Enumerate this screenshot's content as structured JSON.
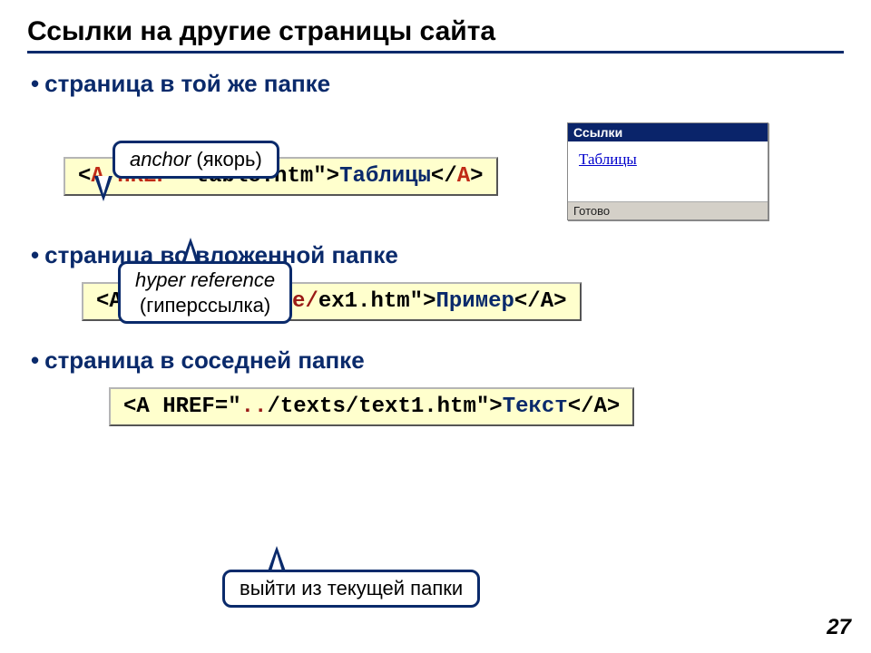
{
  "title": "Ссылки на другие страницы сайта",
  "sections": [
    {
      "heading": "страница в той же папке"
    },
    {
      "heading": "страница во вложенной папке"
    },
    {
      "heading": "страница в соседней папке"
    }
  ],
  "callouts": {
    "anchor": {
      "italic": "anchor",
      "rest": " (якорь)"
    },
    "hyper": {
      "italic": "hyper reference",
      "rest": "(гиперссылка)"
    },
    "exit": {
      "text": "выйти из текущей папки"
    }
  },
  "code1": {
    "lt": "<",
    "a_open": "A",
    "sp": " ",
    "href": "HREF",
    "eq": "=",
    "q1": "\"",
    "url": "table.htm",
    "q2": "\"",
    "gt": ">",
    "text": "Таблицы",
    "lt2": "<",
    "slash": "/",
    "a_close": "A",
    "gt2": ">"
  },
  "code2": {
    "prefix": "<A HREF=\"",
    "path_red": "example/",
    "path_rest": "ex1.htm",
    "mid": "\">",
    "text": "Пример",
    "suffix": "</A>"
  },
  "code3": {
    "prefix": "<A HREF=\"",
    "dots": "..",
    "path_rest": "/texts/text1.htm",
    "mid": "\">",
    "text": "Текст",
    "suffix": "</A>"
  },
  "browser": {
    "title": "Ссылки",
    "link": "Таблицы",
    "status": "Готово"
  },
  "page_number": "27"
}
